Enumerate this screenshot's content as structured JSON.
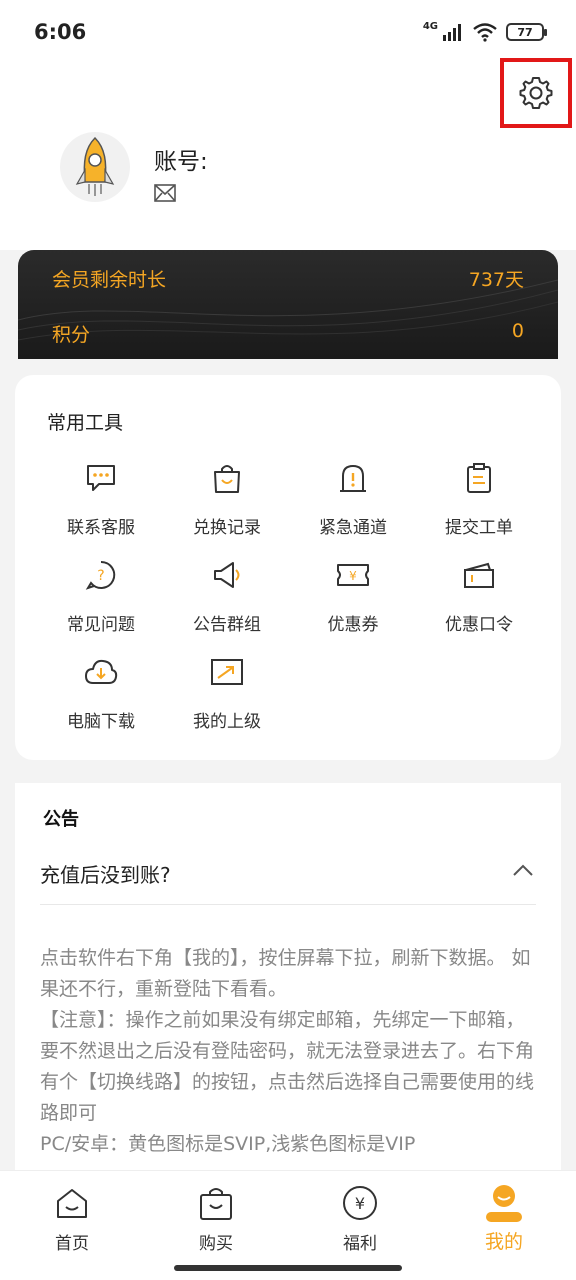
{
  "status_bar": {
    "time": "6:06",
    "network": "4G",
    "battery": "77"
  },
  "header": {
    "account_label": "账号:"
  },
  "membership": {
    "remaining_label": "会员剩余时长",
    "remaining_value": "737天",
    "points_label": "积分",
    "points_value": "0"
  },
  "tools": {
    "title": "常用工具",
    "items": [
      {
        "label": "联系客服",
        "icon": "chat-icon"
      },
      {
        "label": "兑换记录",
        "icon": "shopping-bag-icon"
      },
      {
        "label": "紧急通道",
        "icon": "alert-icon"
      },
      {
        "label": "提交工单",
        "icon": "clipboard-icon"
      },
      {
        "label": "常见问题",
        "icon": "question-icon"
      },
      {
        "label": "公告群组",
        "icon": "megaphone-icon"
      },
      {
        "label": "优惠券",
        "icon": "coupon-icon"
      },
      {
        "label": "优惠口令",
        "icon": "ticket-icon"
      },
      {
        "label": "电脑下载",
        "icon": "cloud-download-icon"
      },
      {
        "label": "我的上级",
        "icon": "trend-icon"
      }
    ]
  },
  "notice": {
    "title": "公告",
    "question": "充值后没到账?",
    "answer_lines": [
      "点击软件右下角【我的】，按住屏幕下拉，刷新下数据。 如果还不行，重新登陆下看看。",
      "【注意】：操作之前如果没有绑定邮箱，先绑定一下邮箱，要不然退出之后没有登陆密码，就无法登录进去了。右下角有个【切换线路】的按钮，点击然后选择自己需要使用的线路即可",
      "PC/安卓：黄色图标是SVIP,浅紫色图标是VIP"
    ]
  },
  "bottom_nav": [
    {
      "label": "首页",
      "icon": "home-icon",
      "active": false
    },
    {
      "label": "购买",
      "icon": "bag-icon",
      "active": false
    },
    {
      "label": "福利",
      "icon": "yen-icon",
      "active": false
    },
    {
      "label": "我的",
      "icon": "profile-icon",
      "active": true
    }
  ],
  "colors": {
    "accent": "#f5a623",
    "highlight_border": "#e21818"
  }
}
